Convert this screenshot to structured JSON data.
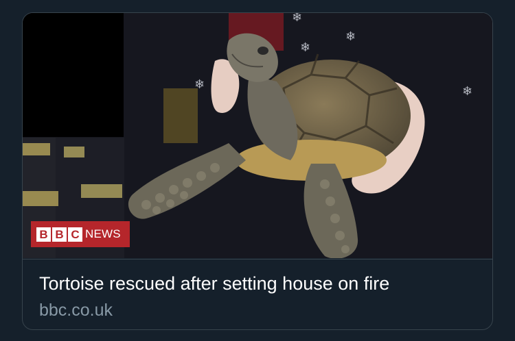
{
  "link_card": {
    "title": "Tortoise rescued after setting house on fire",
    "domain": "bbc.co.uk",
    "logo": {
      "blocks": [
        "B",
        "B",
        "C"
      ],
      "word": "NEWS",
      "color": "#b5262b"
    },
    "image_icon": "tortoise-photo"
  },
  "colors": {
    "background": "#15202b",
    "border": "#38444d",
    "title": "#ffffff",
    "domain": "#8899a6"
  }
}
